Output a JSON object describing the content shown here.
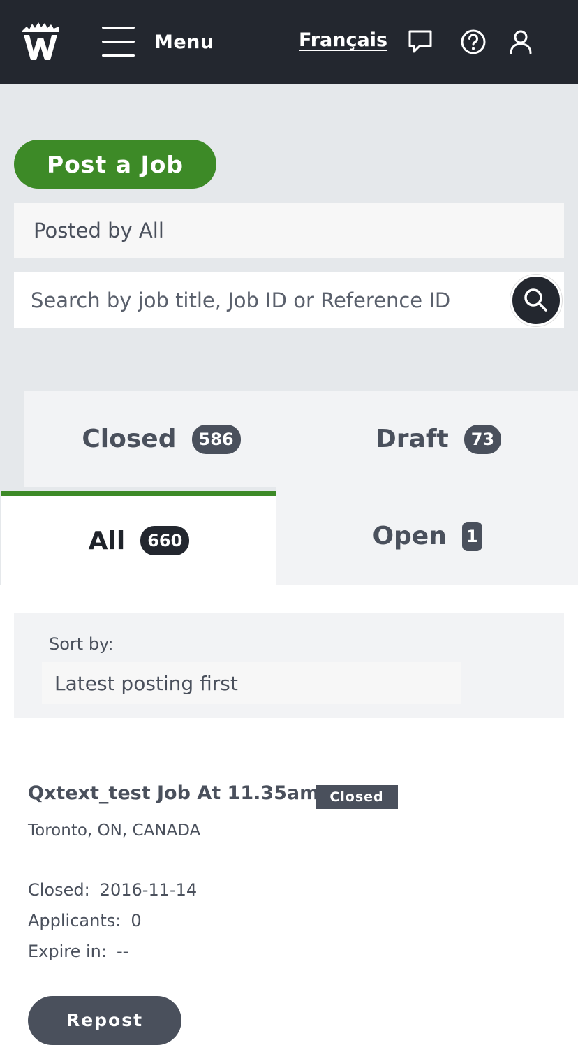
{
  "header": {
    "menu_label": "Menu",
    "language_link": "Français",
    "icons": [
      "logo-w-icon",
      "hamburger-icon",
      "chat-icon",
      "help-icon",
      "user-icon"
    ]
  },
  "actions": {
    "post_job_label": "Post a Job"
  },
  "filters": {
    "posted_by": "Posted by All",
    "search_placeholder": "Search by job title, Job ID or Reference ID"
  },
  "tabs": [
    {
      "label": "Closed",
      "count": "586"
    },
    {
      "label": "Draft",
      "count": "73"
    },
    {
      "label": "All",
      "count": "660"
    },
    {
      "label": "Open",
      "count": "1"
    }
  ],
  "active_tab": "All",
  "sort": {
    "label": "Sort by:",
    "selected": "Latest posting first"
  },
  "job": {
    "title": "Qxtext_test Job At 11.35am",
    "status": "Closed",
    "location": "Toronto, ON, CANADA",
    "closed_label": "Closed:",
    "closed_value": "2016-11-14",
    "applicants_label": "Applicants:",
    "applicants_value": "0",
    "expire_label": "Expire in:",
    "expire_value": "--",
    "repost_label": "Repost"
  },
  "colors": {
    "header_bg": "#23272f",
    "accent_green": "#3d8a27",
    "badge_grey": "#4a505c",
    "page_grey": "#e5e8eb"
  }
}
